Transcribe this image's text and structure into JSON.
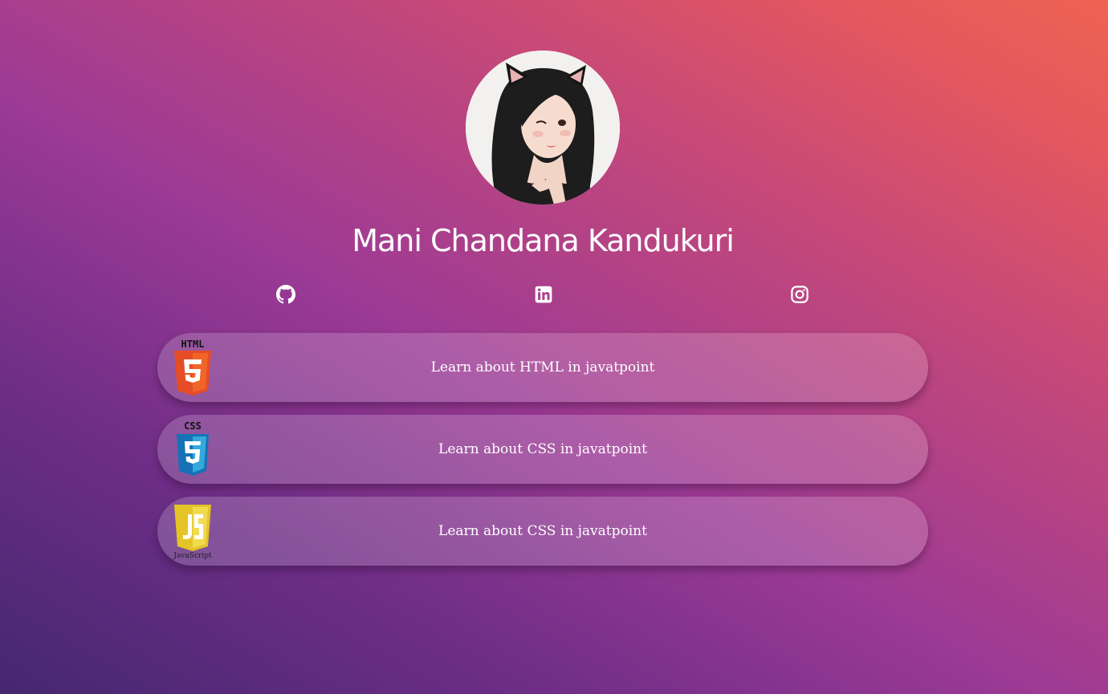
{
  "profile": {
    "name": "Mani Chandana Kandukuri"
  },
  "social": [
    {
      "icon": "github-icon"
    },
    {
      "icon": "linkedin-icon"
    },
    {
      "icon": "instagram-icon"
    }
  ],
  "links": [
    {
      "label": "Learn about HTML in javatpoint",
      "logo": "html5-logo",
      "logo_text": "HTML"
    },
    {
      "label": "Learn about CSS in javatpoint",
      "logo": "css3-logo",
      "logo_text": "CSS"
    },
    {
      "label": "Learn about CSS in javatpoint",
      "logo": "javascript-logo",
      "logo_text": "JavaScript"
    }
  ],
  "colors": {
    "html_orange": "#e44d26",
    "css_blue": "#1572b6",
    "js_yellow": "#f0db4f"
  }
}
